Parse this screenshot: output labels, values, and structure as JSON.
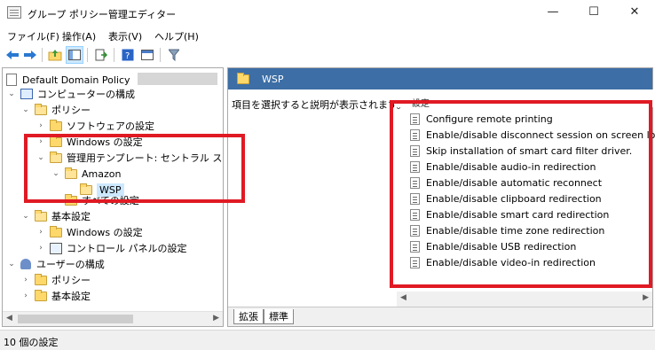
{
  "window": {
    "title": "グループ ポリシー管理エディター",
    "minimize": "—",
    "maximize": "☐",
    "close": "✕"
  },
  "menu": [
    "ファイル(F)",
    "操作(A)",
    "表示(V)",
    "ヘルプ(H)"
  ],
  "toolbar": {
    "icons": [
      "back-arrow-icon",
      "forward-arrow-icon",
      "folder-up-icon",
      "show-hide-tree-icon",
      "export-list-icon",
      "help-icon",
      "properties-icon",
      "filter-icon"
    ]
  },
  "tree": {
    "root": "Default Domain Policy",
    "items": [
      {
        "label": "コンピューターの構成",
        "level": 1,
        "expanded": true
      },
      {
        "label": "ポリシー",
        "level": 2,
        "expanded": true
      },
      {
        "label": "ソフトウェアの設定",
        "level": 3,
        "expanded": false
      },
      {
        "label": "Windows の設定",
        "level": 3,
        "expanded": false
      },
      {
        "label": "管理用テンプレート: セントラル ストアから",
        "level": 3,
        "expanded": true
      },
      {
        "label": "Amazon",
        "level": 4,
        "expanded": true
      },
      {
        "label": "WSP",
        "level": 5,
        "selected": true
      },
      {
        "label": "すべての設定",
        "level": 4
      },
      {
        "label": "基本設定",
        "level": 2,
        "expanded": true
      },
      {
        "label": "Windows の設定",
        "level": 3,
        "expanded": false
      },
      {
        "label": "コントロール パネルの設定",
        "level": 3,
        "expanded": false
      },
      {
        "label": "ユーザーの構成",
        "level": 1,
        "expanded": true
      },
      {
        "label": "ポリシー",
        "level": 2,
        "expanded": false
      },
      {
        "label": "基本設定",
        "level": 2,
        "expanded": false
      }
    ]
  },
  "detail": {
    "header": "WSP",
    "description": "項目を選択すると説明が表示されます。",
    "column_header": "設定",
    "settings": [
      "Configure remote printing",
      "Enable/disable disconnect session on screen lock.",
      "Skip installation of smart card filter driver.",
      "Enable/disable audio-in redirection",
      "Enable/disable automatic reconnect",
      "Enable/disable clipboard redirection",
      "Enable/disable smart card redirection",
      "Enable/disable time zone redirection",
      "Enable/disable USB redirection",
      "Enable/disable video-in redirection"
    ],
    "tabs": [
      "拡張",
      "標準"
    ]
  },
  "status": {
    "text": "10 個の設定"
  },
  "colors": {
    "header_bg": "#3d6ea5",
    "highlight_red": "#e01a24",
    "selection": "#cce8ff"
  }
}
